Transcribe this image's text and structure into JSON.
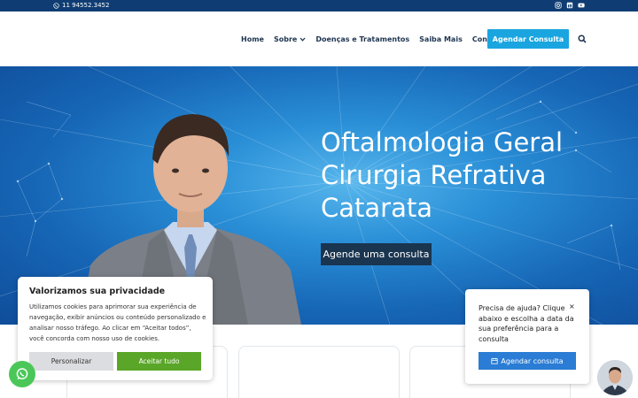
{
  "topbar": {
    "phone": "11 94552.3452",
    "socials": [
      "instagram-icon",
      "linkedin-icon",
      "youtube-icon"
    ]
  },
  "nav": {
    "items": [
      {
        "label": "Home"
      },
      {
        "label": "Sobre"
      },
      {
        "label": "Doenças e Tratamentos"
      },
      {
        "label": "Saiba Mais"
      },
      {
        "label": "Contato"
      }
    ],
    "cta": "Agendar Consulta"
  },
  "hero": {
    "lines": [
      "Oftalmologia Geral",
      "Cirurgia Refrativa",
      "Catarata"
    ],
    "button": "Agende uma consulta"
  },
  "cookie": {
    "title": "Valorizamos sua privacidade",
    "text": "Utilizamos cookies para aprimorar sua experiência de navegação, exibir anúncios ou conteúdo personalizado e analisar nosso tráfego. Ao clicar em “Aceitar todos”, você concorda com nosso uso de cookies.",
    "customize": "Personalizar",
    "accept": "Aceitar tudo"
  },
  "help": {
    "text": "Precisa de ajuda? Clique abaixo e escolha a data da sua preferência para a consulta",
    "close": "×",
    "button": "Agendar consulta"
  },
  "colors": {
    "topbar": "#0f3d73",
    "accent": "#1aa5e0",
    "heroButton": "#1a3550",
    "accept": "#5aa628",
    "whatsapp": "#4bc75a"
  }
}
